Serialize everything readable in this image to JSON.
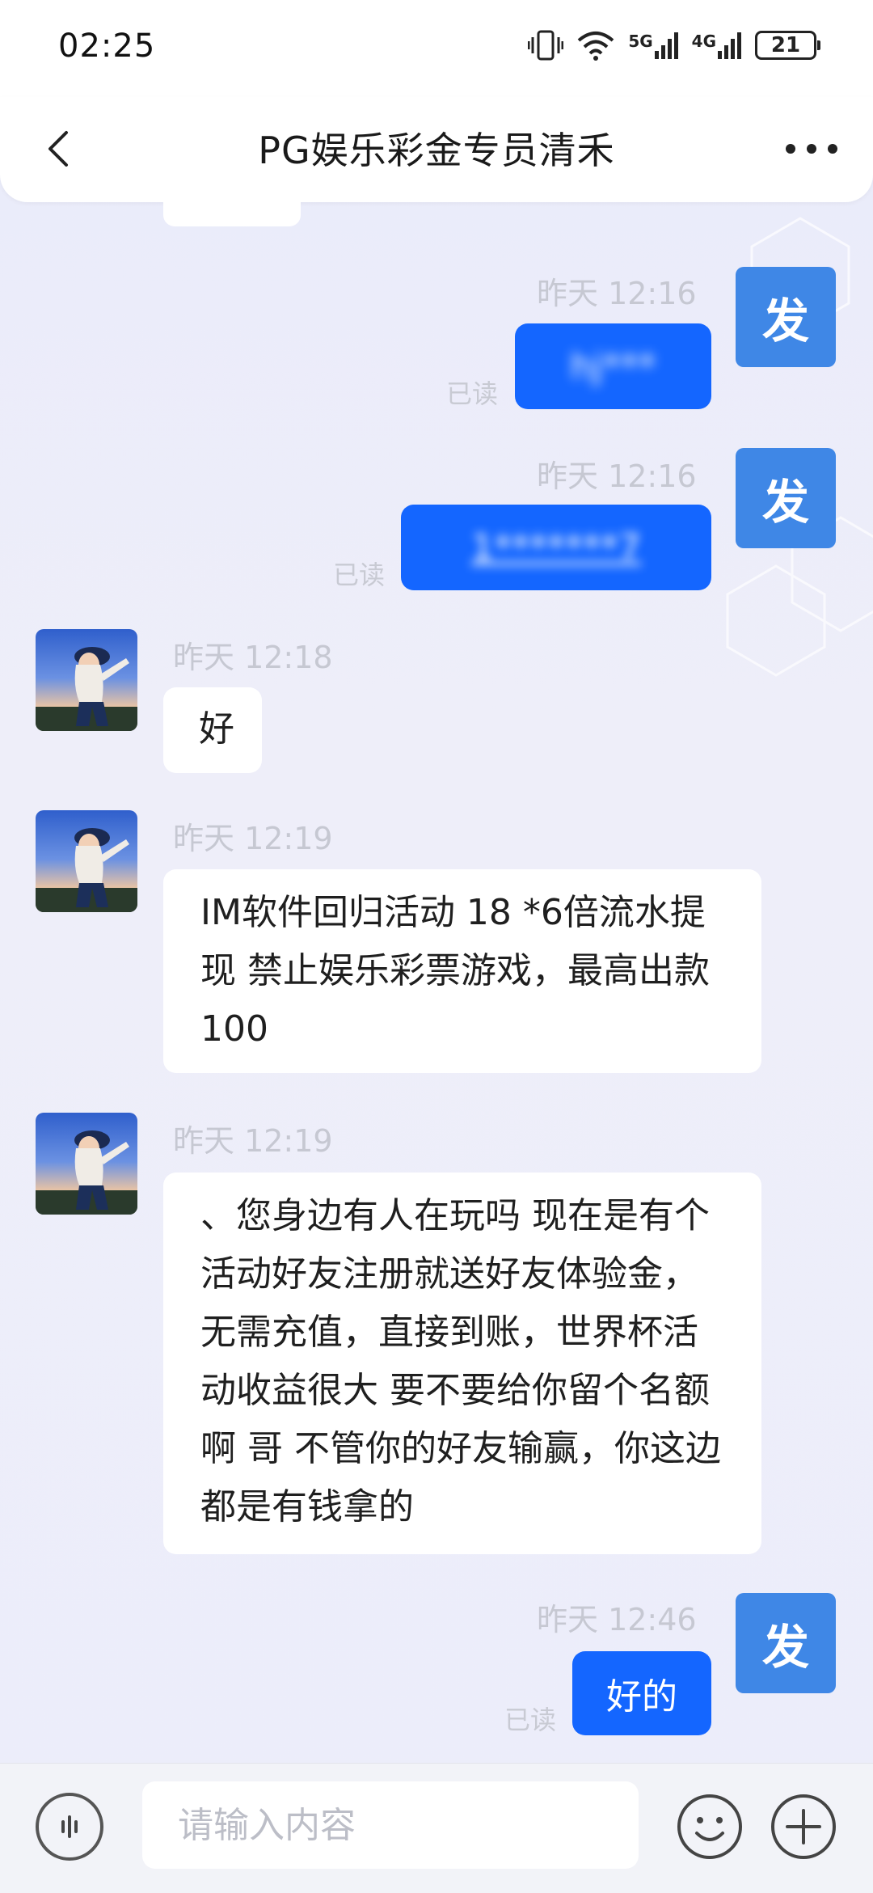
{
  "status_bar": {
    "time": "02:25",
    "signal_5g": "5G",
    "signal_4g": "4G",
    "battery": "21"
  },
  "header": {
    "title": "PG娱乐彩金专员清禾"
  },
  "messages": [
    {
      "direction": "out",
      "time": "昨天 12:16",
      "text": "hj***",
      "status": "已读",
      "avatar": "发"
    },
    {
      "direction": "out",
      "time": "昨天 12:16",
      "text": "1*******7",
      "status": "已读",
      "avatar": "发"
    },
    {
      "direction": "in",
      "time": "昨天 12:18",
      "text": "好"
    },
    {
      "direction": "in",
      "time": "昨天 12:19",
      "text": "IM软件回归活动 18 *6倍流水提现 禁止娱乐彩票游戏，最高出款100"
    },
    {
      "direction": "in",
      "time": "昨天 12:19",
      "text": "、您身边有人在玩吗 现在是有个活动好友注册就送好友体验金，无需充值，直接到账，世界杯活动收益很大 要不要给你留个名额啊 哥 不管你的好友输赢，你这边都是有钱拿的"
    },
    {
      "direction": "out",
      "time": "昨天 12:46",
      "text": "好的",
      "status": "已读",
      "avatar": "发"
    }
  ],
  "input_bar": {
    "placeholder": "请输入内容"
  },
  "colors": {
    "accent": "#1466ff",
    "avatar_me": "#3f87e6",
    "background": "#eceefa"
  }
}
